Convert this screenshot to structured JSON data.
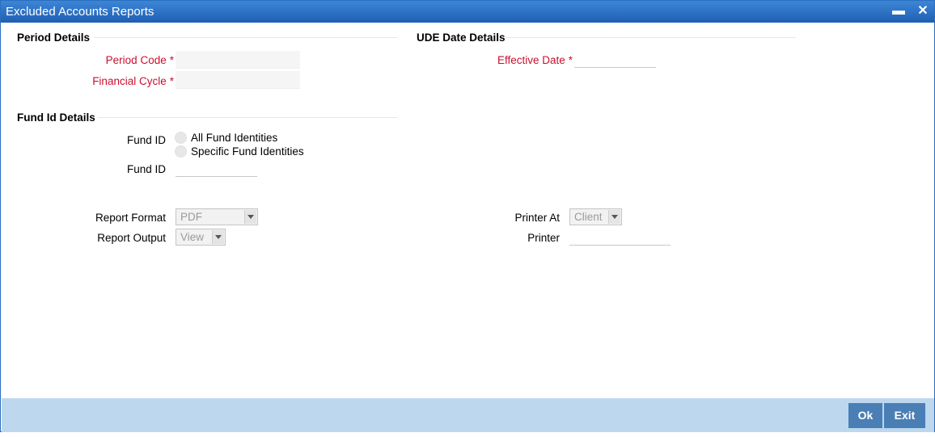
{
  "window": {
    "title": "Excluded Accounts Reports"
  },
  "period_details": {
    "title": "Period Details",
    "period_code_label": "Period Code",
    "financial_cycle_label": "Financial Cycle",
    "period_code_value": "",
    "financial_cycle_value": ""
  },
  "ude_date_details": {
    "title": "UDE Date Details",
    "effective_date_label": "Effective Date",
    "effective_date_value": ""
  },
  "fund_id_details": {
    "title": "Fund Id Details",
    "fund_id_label": "Fund ID",
    "option_all": "All Fund Identities",
    "option_specific": "Specific Fund Identities",
    "fund_id_input_label": "Fund ID",
    "fund_id_value": ""
  },
  "report": {
    "format_label": "Report Format",
    "format_value": "PDF",
    "output_label": "Report Output",
    "output_value": "View",
    "printer_at_label": "Printer At",
    "printer_at_value": "Client",
    "printer_label": "Printer",
    "printer_value": ""
  },
  "required_marker": "*",
  "icons": {
    "minimize": "minimize-icon",
    "close": "close-icon"
  },
  "footer": {
    "ok_label": "Ok",
    "exit_label": "Exit"
  },
  "colors": {
    "titlebar": "#2a6fc0",
    "required": "#c8102e",
    "footer": "#bdd7ee",
    "button": "#4a7fb5"
  }
}
